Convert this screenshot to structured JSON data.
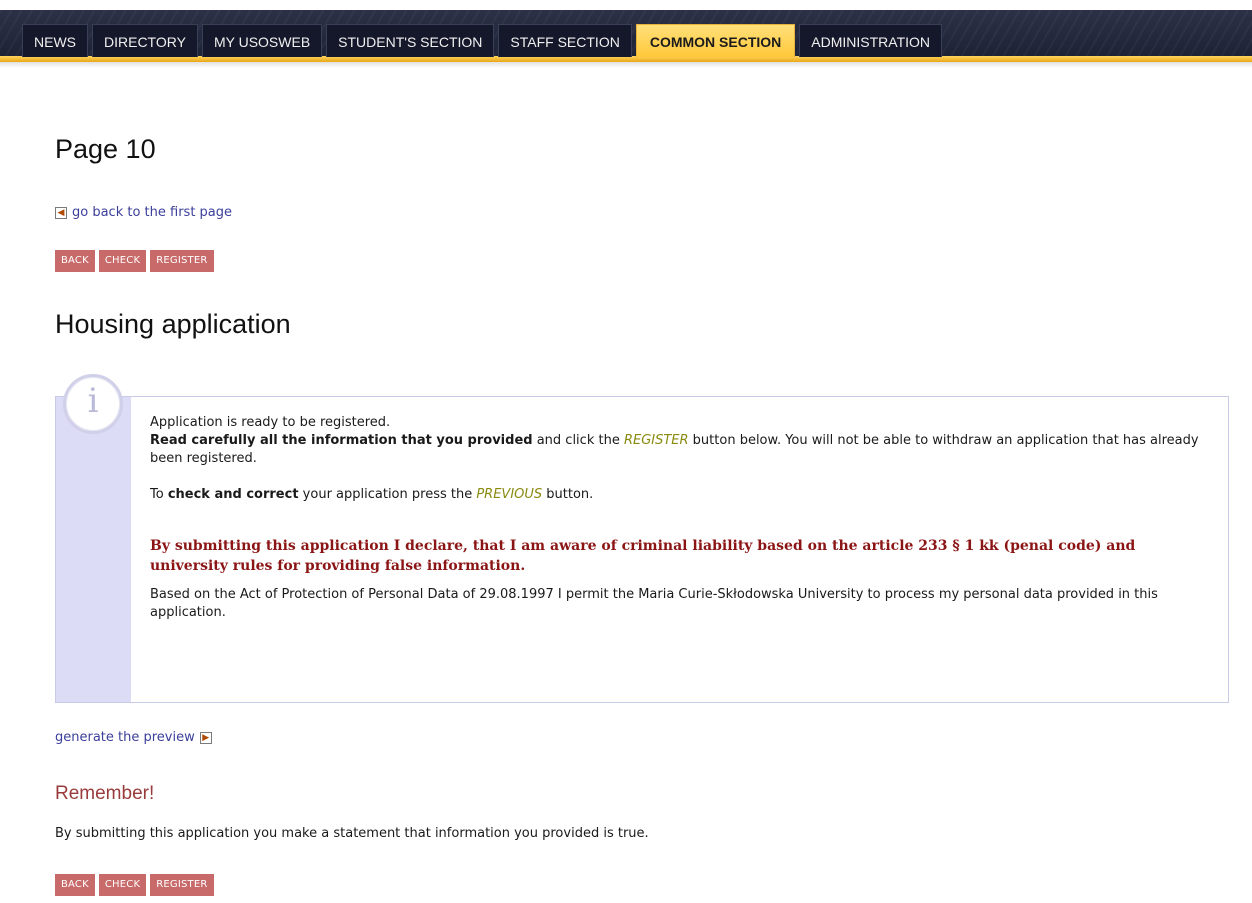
{
  "nav": {
    "tabs": [
      {
        "label": "NEWS"
      },
      {
        "label": "DIRECTORY"
      },
      {
        "label": "MY USOSWEB"
      },
      {
        "label": "STUDENT'S SECTION"
      },
      {
        "label": "STAFF SECTION"
      },
      {
        "label": "COMMON SECTION",
        "active": true
      },
      {
        "label": "ADMINISTRATION"
      }
    ]
  },
  "page": {
    "title": "Page 10",
    "back_link": "go back to the first page",
    "buttons": {
      "back": "BACK",
      "check": "CHECK",
      "register": "REGISTER"
    },
    "section_title": "Housing application"
  },
  "info": {
    "icon": "info-icon",
    "line1": "Application is ready to be registered.",
    "line2_bold": "Read carefully all the information that you provided",
    "line2_mid": " and click the ",
    "line2_italic": "REGISTER",
    "line2_end": " button below. You will not be able to withdraw an application that has already been registered.",
    "line3_start": "To ",
    "line3_bold": "check and correct",
    "line3_mid": " your application press the ",
    "line3_italic": "PREVIOUS",
    "line3_end": " button.",
    "declaration": "By submitting this application I declare, that I am aware of criminal liability based on the article 233 § 1 kk (penal code) and university rules for providing false information.",
    "consent": "Based on the Act of Protection of Personal Data of 29.08.1997 I permit the Maria Curie-Skłodowska University to process my personal data provided in this application."
  },
  "preview_link": "generate the preview",
  "remember": {
    "title": "Remember!",
    "text": "By submitting this application you make a statement that information you provided is true."
  },
  "colors": {
    "accent": "#ffc83a",
    "button_bg": "#c86a6a",
    "link": "#3b3f9b",
    "declaration": "#8b1515"
  }
}
